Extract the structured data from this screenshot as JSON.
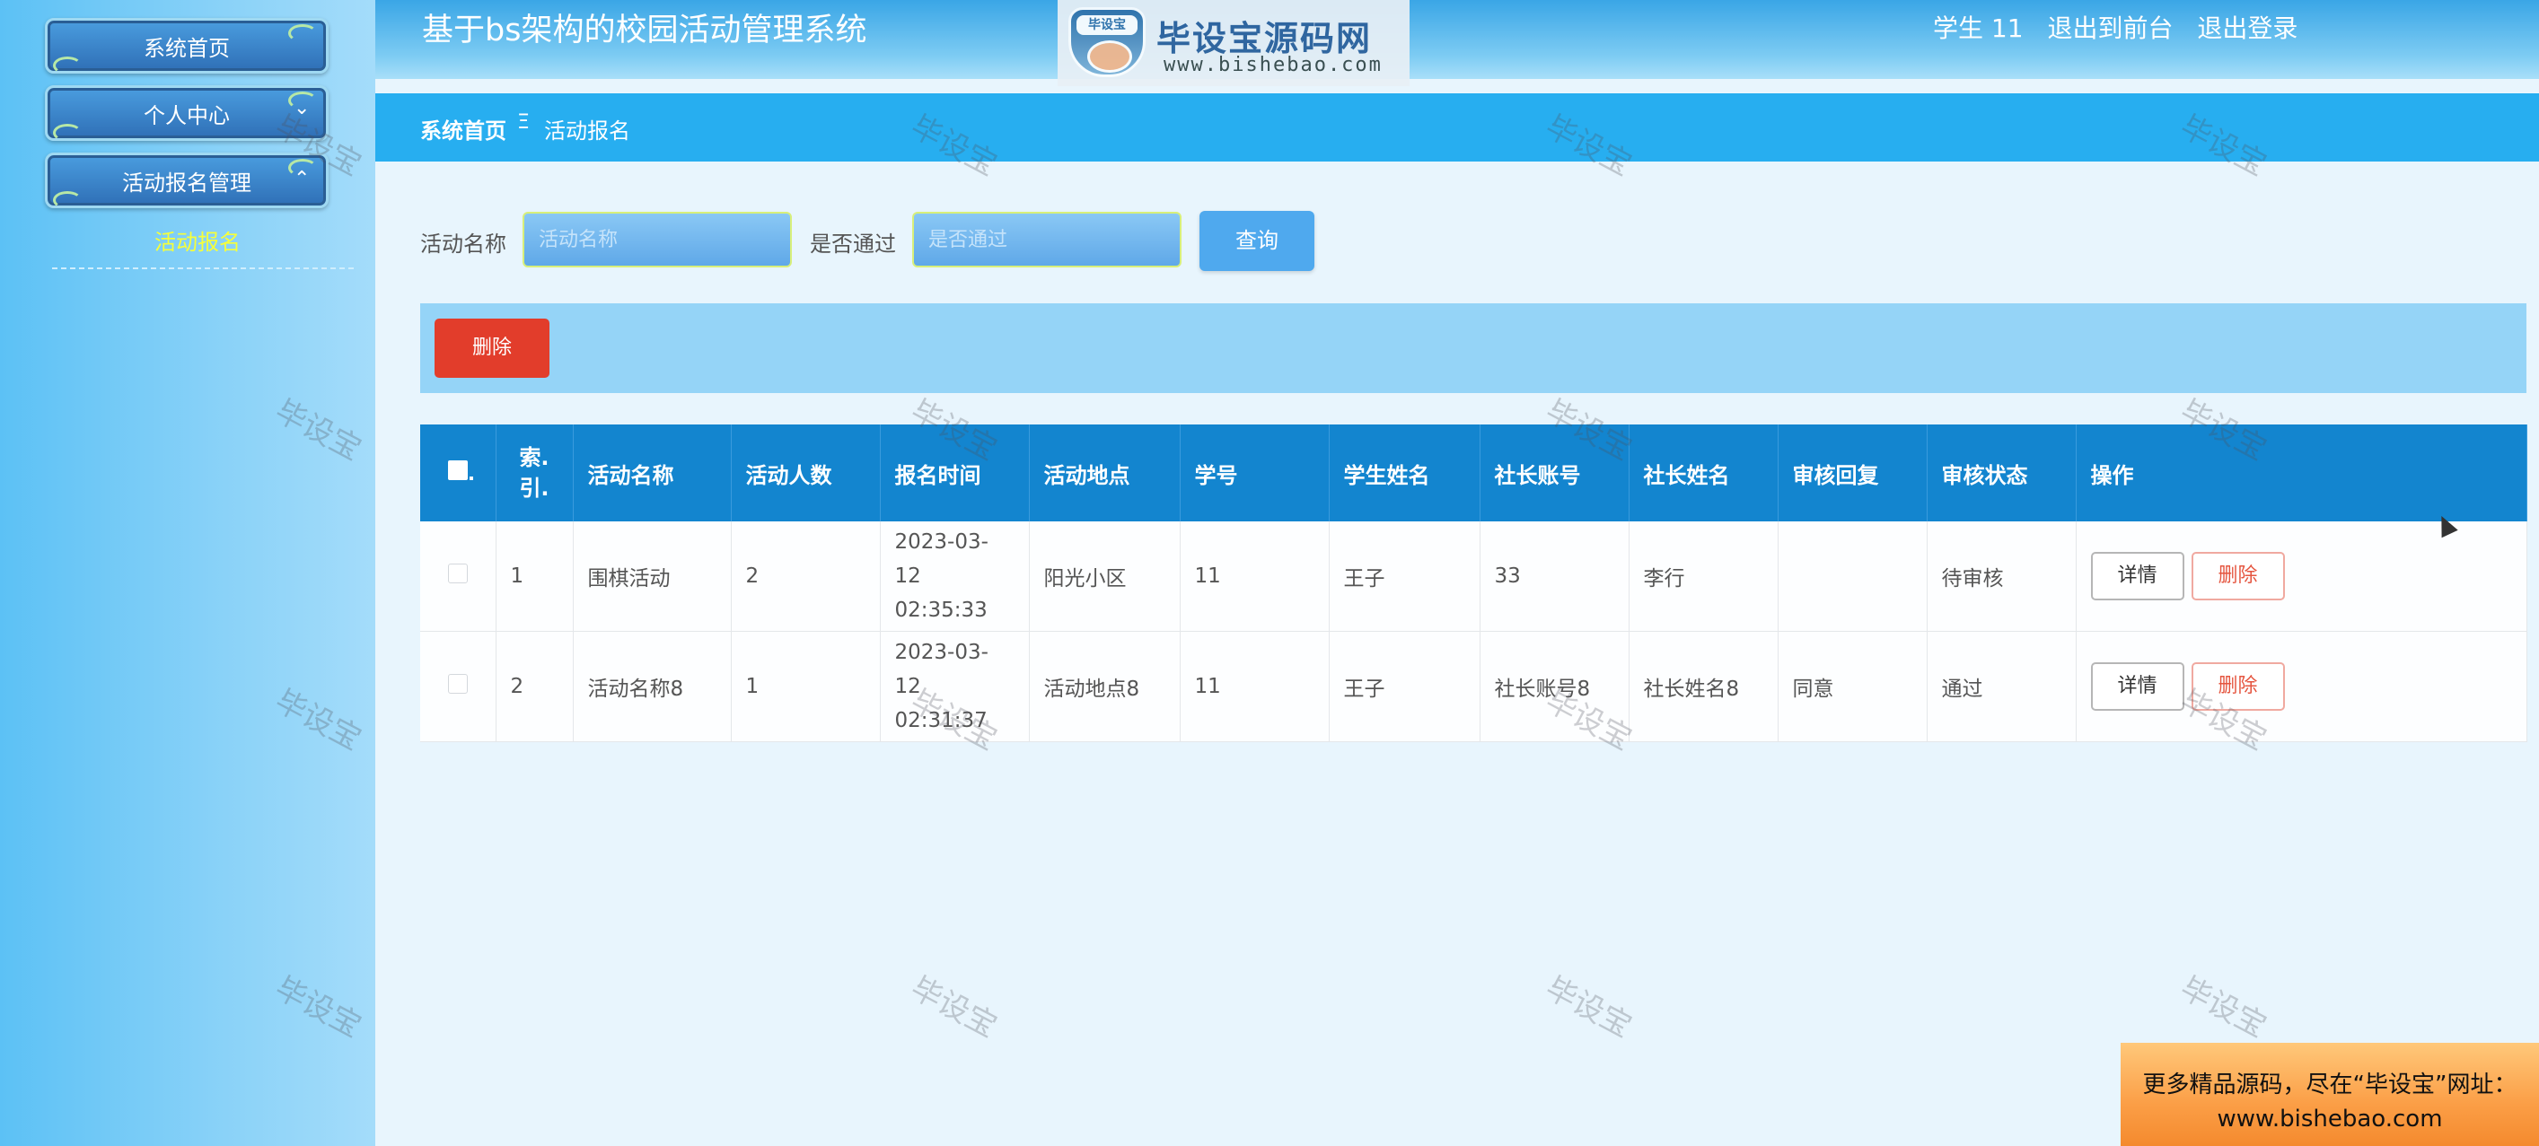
{
  "sidebar": {
    "items": [
      {
        "label": "系统首页"
      },
      {
        "label": "个人中心"
      },
      {
        "label": "活动报名管理"
      }
    ],
    "sub_active": "活动报名"
  },
  "header": {
    "title": "基于bs架构的校园活动管理系统",
    "logo_text": "毕设宝源码网",
    "logo_badge": "毕设宝",
    "logo_url": "www.bishebao.com",
    "user": "学生 11",
    "back_front": "退出到前台",
    "logout": "退出登录"
  },
  "breadcrumb": {
    "home": "系统首页",
    "separator": "Ξ",
    "current": "活动报名"
  },
  "search": {
    "activity_name_label": "活动名称",
    "activity_name_placeholder": "活动名称",
    "pass_label": "是否通过",
    "pass_placeholder": "是否通过",
    "query_button": "查询"
  },
  "actions": {
    "delete_button": "删除"
  },
  "table": {
    "headers": [
      "索引",
      "活动名称",
      "活动人数",
      "报名时间",
      "活动地点",
      "学号",
      "学生姓名",
      "社长账号",
      "社长姓名",
      "审核回复",
      "审核状态",
      "操作"
    ],
    "index_header_line1": "索.",
    "index_header_line2": "引.",
    "rows": [
      {
        "index": "1",
        "name": "围棋活动",
        "count": "2",
        "date": "2023-03-12",
        "time": "02:35:33",
        "place": "阳光小区",
        "student_no": "11",
        "student_name": "王子",
        "leader_account": "33",
        "leader_name": "李行",
        "reply": "",
        "status": "待审核",
        "detail": "详情",
        "delete": "删除"
      },
      {
        "index": "2",
        "name": "活动名称8",
        "count": "1",
        "date": "2023-03-12",
        "time": "02:31:37",
        "place": "活动地点8",
        "student_no": "11",
        "student_name": "王子",
        "leader_account": "社长账号8",
        "leader_name": "社长姓名8",
        "reply": "同意",
        "status": "通过",
        "detail": "详情",
        "delete": "删除"
      }
    ]
  },
  "watermark": "毕设宝",
  "banner": {
    "line1": "更多精品源码，尽在“毕设宝”网址：",
    "line2": "www.bishebao.com"
  },
  "colors": {
    "sidebar": "#5cc1f5",
    "breadcrumb": "#27aef0",
    "table_header": "#1385cf",
    "delete": "#e23d2b",
    "active_sub": "#f6ff3a"
  }
}
